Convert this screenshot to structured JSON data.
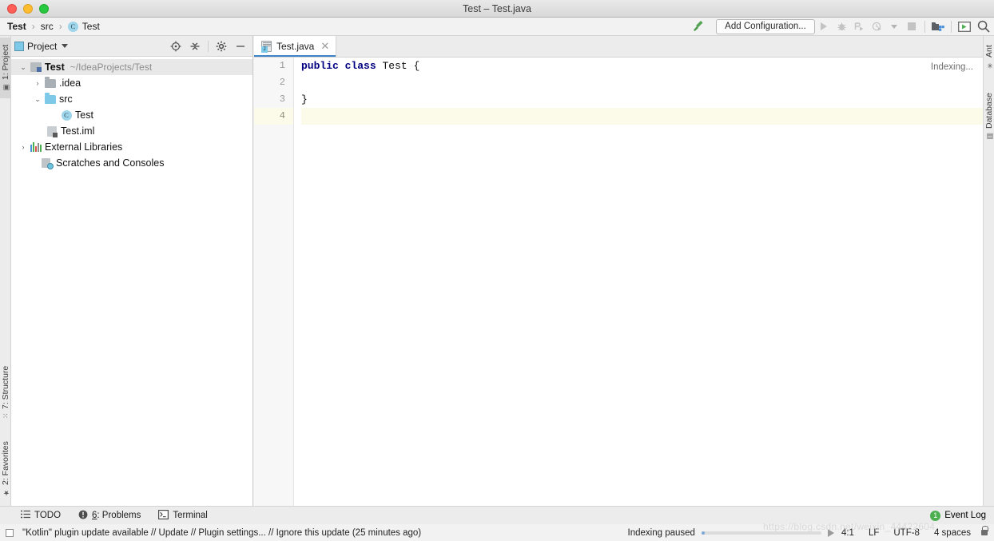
{
  "window": {
    "title": "Test – Test.java",
    "traffic_lights": [
      "close-red",
      "minimize-yellow",
      "zoom-green"
    ]
  },
  "navbar": {
    "breadcrumb": [
      {
        "label": "Test",
        "icon": "project-icon"
      },
      {
        "label": "src",
        "icon": "folder-icon"
      },
      {
        "label": "Test",
        "icon": "class-badge",
        "badge": "C"
      }
    ],
    "separator": "›",
    "build_icon": "hammer-icon",
    "add_configuration": "Add Configuration...",
    "run_icon": "run-icon",
    "debug_icon": "debug-icon",
    "run_with_coverage_icon": "run-with-coverage-icon",
    "profile_icon": "profile-icon",
    "profile_dropdown_icon": "chevron-down-icon",
    "stop_icon": "stop-icon",
    "project_structure_icon": "project-structure-icon",
    "run_console_icon": "run-console-icon",
    "search_icon": "search-icon"
  },
  "left_strip": {
    "items": [
      {
        "label": "1: Project",
        "icon": "project-tool-icon",
        "active": true
      },
      {
        "label": "7: Structure",
        "icon": "structure-tool-icon",
        "active": false
      },
      {
        "label": "2: Favorites",
        "icon": "favorites-star-icon",
        "active": false
      }
    ]
  },
  "right_strip": {
    "items": [
      {
        "label": "Ant",
        "icon": "ant-icon"
      },
      {
        "label": "Database",
        "icon": "database-icon"
      }
    ]
  },
  "project_panel": {
    "title": "Project",
    "title_icon": "project-view-icon",
    "dropdown_icon": "chevron-down-icon",
    "toolbar": [
      {
        "name": "locate-icon",
        "glyph": "target"
      },
      {
        "name": "collapse-all-icon",
        "glyph": "collapse"
      },
      {
        "name": "settings-gear-icon",
        "glyph": "gear"
      },
      {
        "name": "hide-icon",
        "glyph": "minus"
      }
    ],
    "tree": [
      {
        "label": "Test",
        "sub": "~/IdeaProjects/Test",
        "icon": "module-icon",
        "arrow": "expanded",
        "indent": 0,
        "bold": true,
        "selected": true
      },
      {
        "label": ".idea",
        "sub": "",
        "icon": "folder-grey-icon",
        "arrow": "collapsed",
        "indent": 1,
        "bold": false,
        "selected": false
      },
      {
        "label": "src",
        "sub": "",
        "icon": "folder-source-icon",
        "arrow": "expanded",
        "indent": 1,
        "bold": false,
        "selected": false
      },
      {
        "label": "Test",
        "sub": "",
        "icon": "class-badge",
        "arrow": "none",
        "indent": 2,
        "bold": false,
        "selected": false
      },
      {
        "label": "Test.iml",
        "sub": "",
        "icon": "iml-file-icon",
        "arrow": "none",
        "indent": 1,
        "bold": false,
        "selected": false
      },
      {
        "label": "External Libraries",
        "sub": "",
        "icon": "libraries-icon",
        "arrow": "collapsed",
        "indent": 0,
        "bold": false,
        "selected": false
      },
      {
        "label": "Scratches and Consoles",
        "sub": "",
        "icon": "scratches-icon",
        "arrow": "none",
        "indent": 0,
        "bold": false,
        "selected": false
      }
    ]
  },
  "editor": {
    "tab": {
      "label": "Test.java",
      "icon": "java-file-icon",
      "close_icon": "close-icon"
    },
    "status_hint": "Indexing...",
    "lines": [
      {
        "no": "1",
        "text": "public class Test {",
        "current": false
      },
      {
        "no": "2",
        "text": "",
        "current": false
      },
      {
        "no": "3",
        "text": "}",
        "current": false
      },
      {
        "no": "4",
        "text": "",
        "current": true
      }
    ],
    "keywords": [
      "public",
      "class"
    ],
    "keyword_color": "#000080",
    "current_line_color": "#fcfae8"
  },
  "bottom_strip": {
    "items": [
      {
        "label": "TODO",
        "icon": "todo-list-icon"
      },
      {
        "label": "6: Problems",
        "icon": "problems-warning-icon",
        "underline_prefix": "6"
      },
      {
        "label": "Terminal",
        "icon": "terminal-icon"
      }
    ],
    "event_log": {
      "label": "Event Log",
      "count": "1",
      "badge_color": "#4caf50"
    }
  },
  "statusbar": {
    "checkbox_icon": "checkbox-icon",
    "message": "\"Kotlin\" plugin update available // Update // Plugin settings... // Ignore this update (25 minutes ago)",
    "indexing_label": "Indexing paused",
    "progress_percent": 2,
    "resume_icon": "play-icon",
    "caret_position": "4:1",
    "line_separator": "LF",
    "encoding": "UTF-8",
    "indent": "4 spaces",
    "lock_icon": "lock-icon"
  },
  "watermark": "https://blog.csdn.net/weixin_44422604"
}
